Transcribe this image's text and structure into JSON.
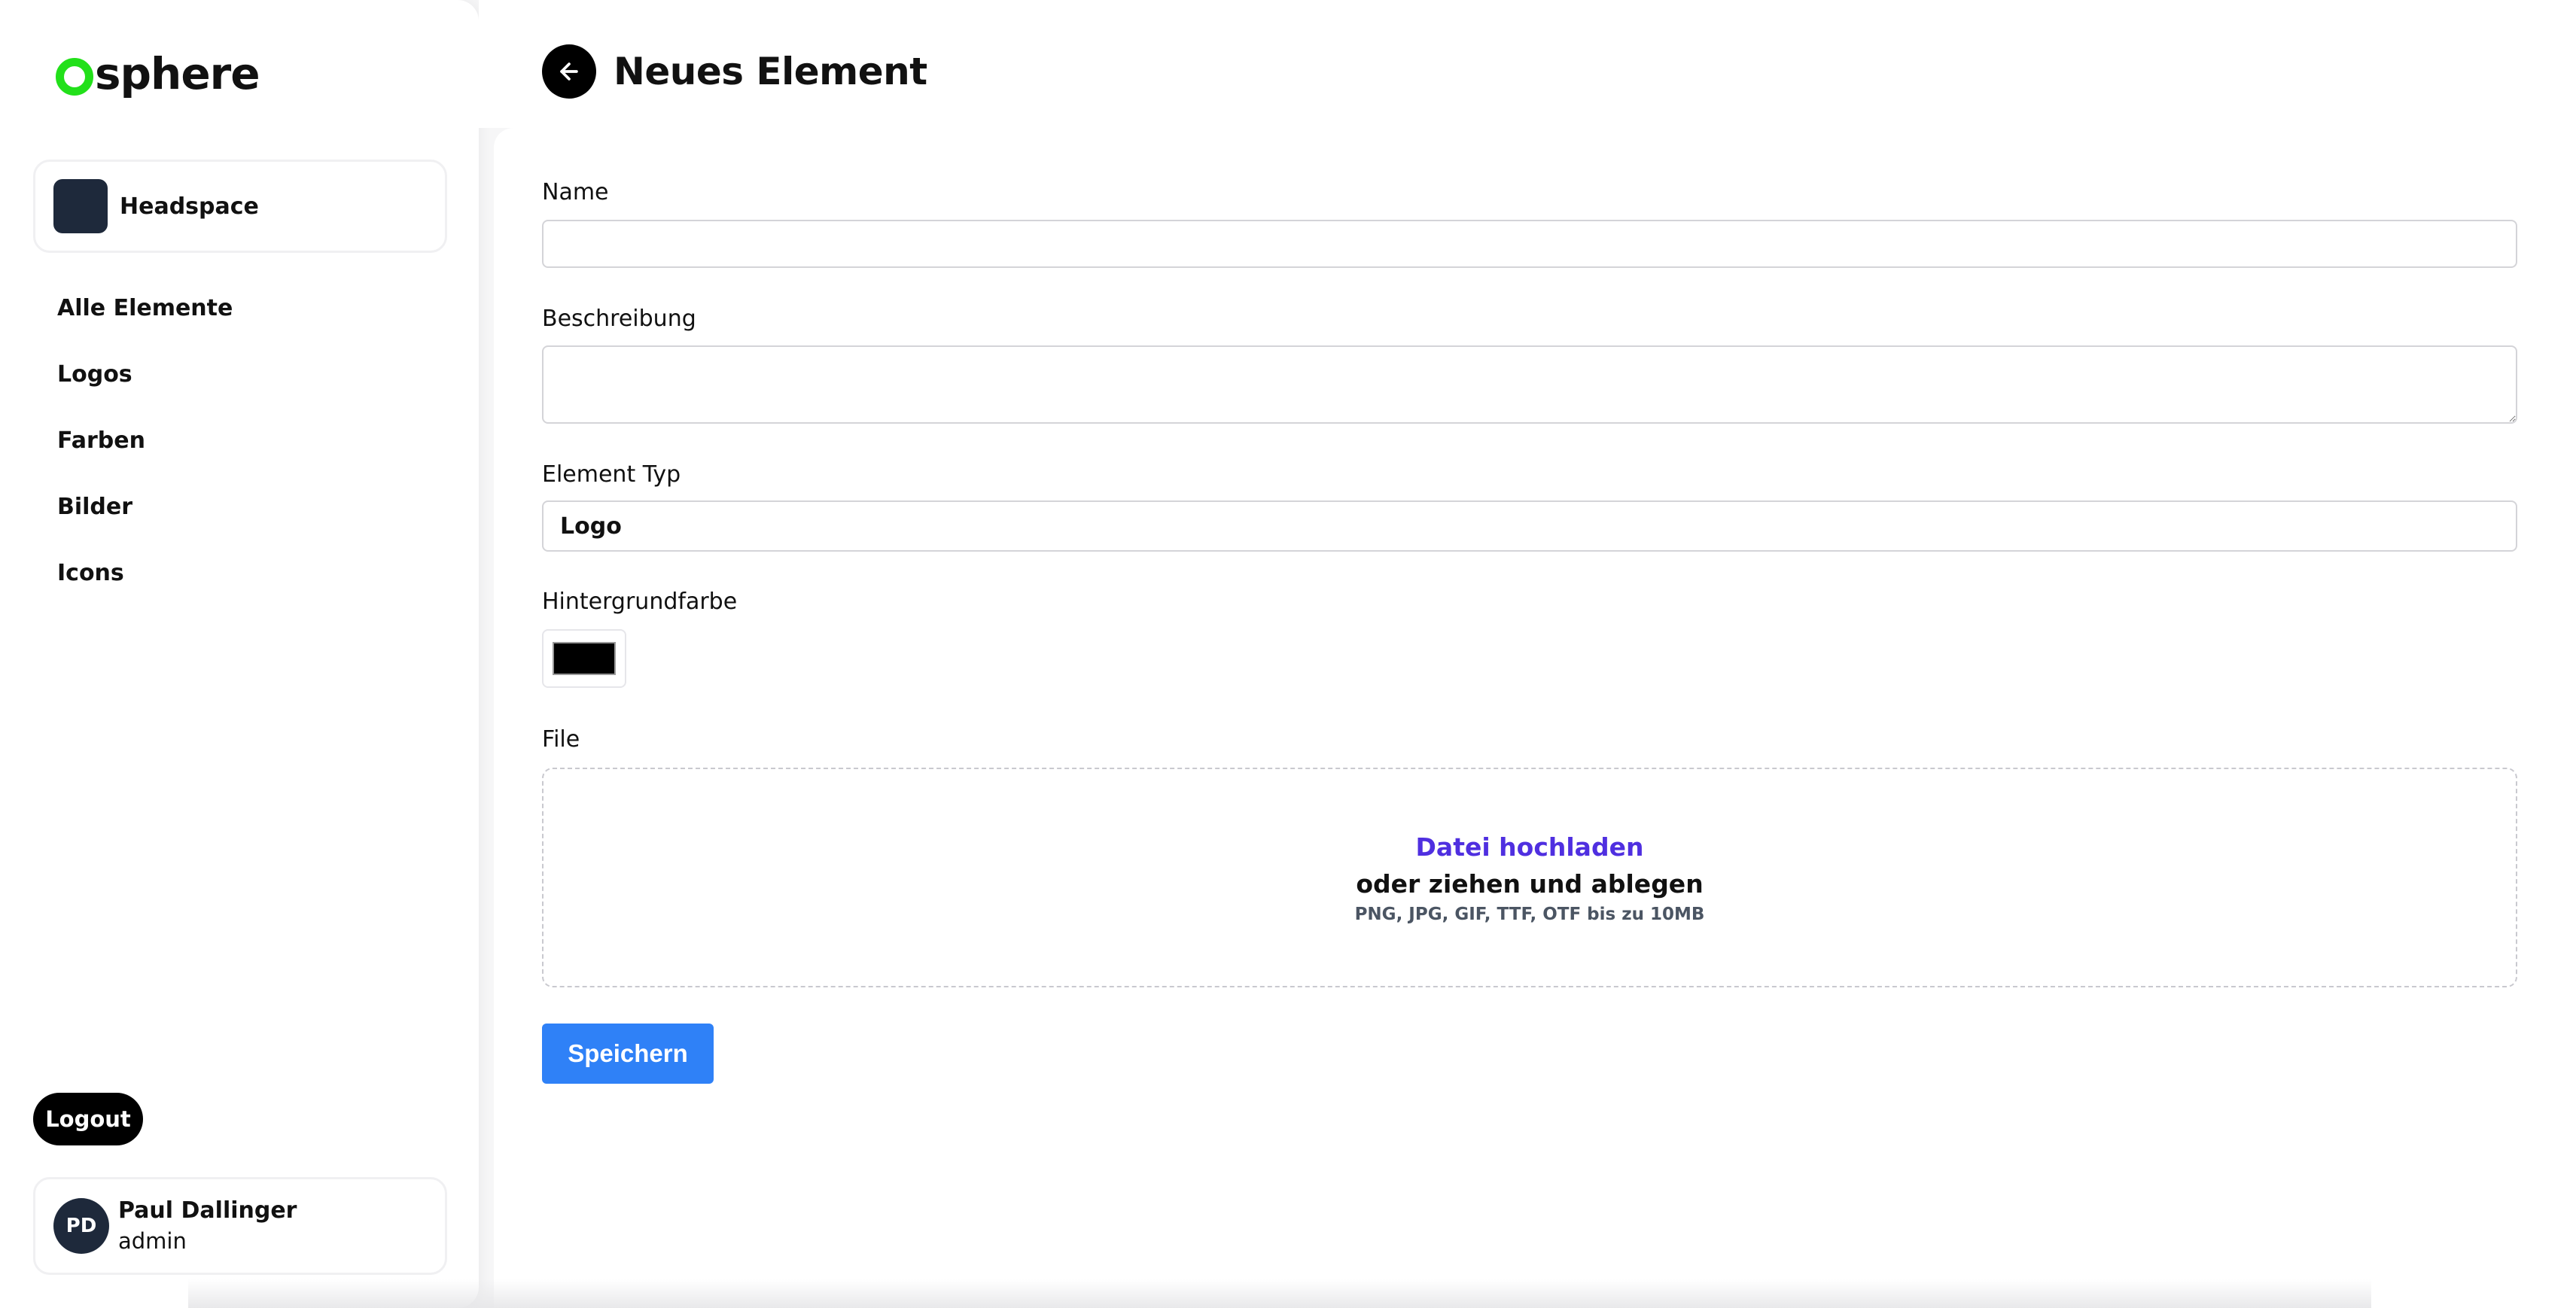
{
  "brand": {
    "name": "sphere",
    "accent_color": "#22e01a"
  },
  "workspace": {
    "name": "Headspace"
  },
  "sidebar": {
    "items": [
      {
        "label": "Alle Elemente"
      },
      {
        "label": "Logos"
      },
      {
        "label": "Farben"
      },
      {
        "label": "Bilder"
      },
      {
        "label": "Icons"
      }
    ],
    "logout_label": "Logout"
  },
  "user": {
    "initials": "PD",
    "name": "Paul Dallinger",
    "role": "admin"
  },
  "page": {
    "title": "Neues Element",
    "back_icon": "arrow-left-icon"
  },
  "form": {
    "name": {
      "label": "Name",
      "value": ""
    },
    "description": {
      "label": "Beschreibung",
      "value": ""
    },
    "element_type": {
      "label": "Element Typ",
      "value": "Logo"
    },
    "background_color": {
      "label": "Hintergrundfarbe",
      "value": "#000000"
    },
    "file": {
      "label": "File",
      "upload_link": "Datei hochladen",
      "drop_text": "oder ziehen und ablegen",
      "hint": "PNG, JPG, GIF, TTF, OTF bis zu 10MB"
    },
    "save_label": "Speichern"
  },
  "colors": {
    "primary_button": "#2f81f7",
    "upload_link": "#4f2fe0"
  }
}
